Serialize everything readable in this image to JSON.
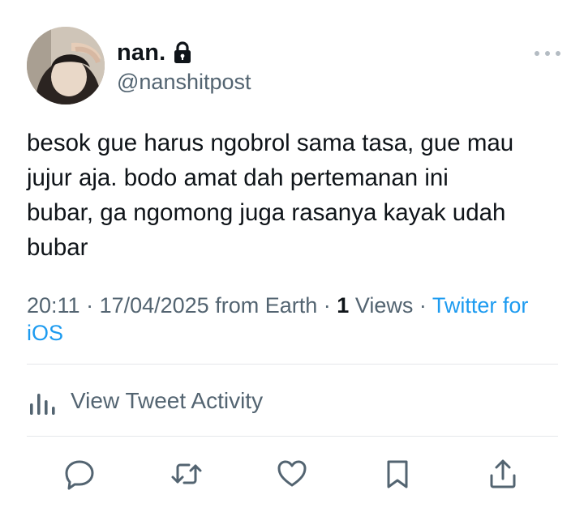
{
  "author": {
    "display_name": "nan.",
    "handle": "@nanshitpost",
    "protected_icon": "lock-icon"
  },
  "tweet": {
    "text": "besok gue harus ngobrol sama tasa, gue mau\njujur aja. bodo amat dah pertemanan ini\nbubar, ga ngomong juga rasanya kayak udah\nbubar"
  },
  "meta": {
    "time": "20:11",
    "date": "17/04/2025",
    "location": "from Earth",
    "separator": " · ",
    "views_count": "1",
    "views_label": "Views",
    "source": "Twitter for iOS"
  },
  "activity": {
    "label": "View Tweet Activity",
    "icon": "bar-chart-icon"
  },
  "actions": [
    {
      "name": "reply",
      "icon": "comment-icon"
    },
    {
      "name": "retweet",
      "icon": "retweet-icon"
    },
    {
      "name": "like",
      "icon": "heart-icon"
    },
    {
      "name": "bookmark",
      "icon": "bookmark-icon"
    },
    {
      "name": "share",
      "icon": "share-icon"
    }
  ],
  "colors": {
    "text": "#0f1419",
    "secondary": "#536471",
    "link": "#1d9bf0",
    "divider": "#e4e7ea"
  }
}
